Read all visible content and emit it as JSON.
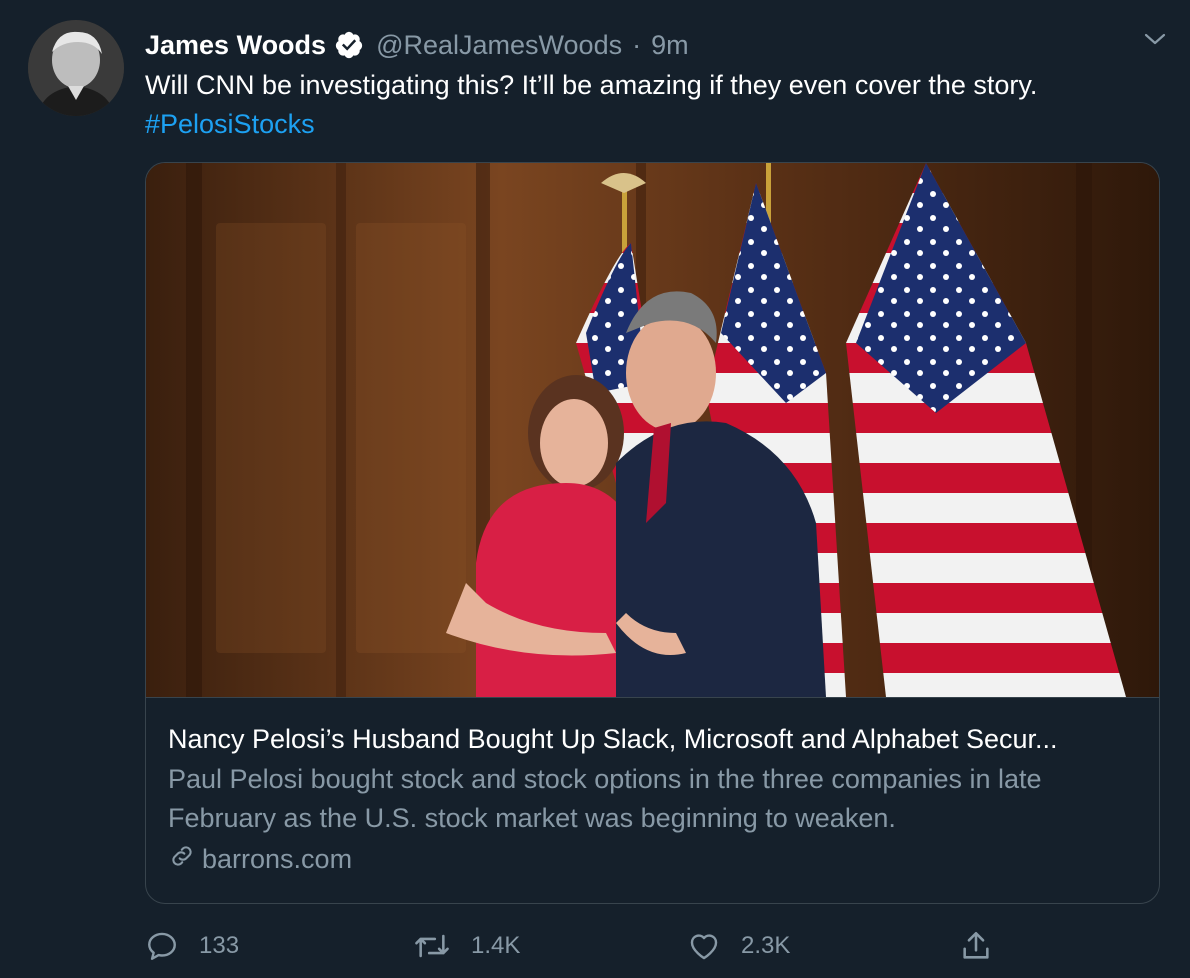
{
  "tweet": {
    "author_name": "James Woods",
    "handle": "@RealJamesWoods",
    "separator": "·",
    "time": "9m",
    "text": "Will CNN be investigating this? It’ll be amazing if they even cover the story.",
    "hashtag": "#PelosiStocks"
  },
  "card": {
    "title": "Nancy Pelosi’s Husband Bought Up Slack, Microsoft and Alphabet Secur...",
    "description": "Paul Pelosi bought stock and stock options in the three companies in late February as the U.S. stock market was beginning to weaken.",
    "domain": "barrons.com"
  },
  "actions": {
    "replies": "133",
    "retweets": "1.4K",
    "likes": "2.3K"
  },
  "icons": {
    "verified": "verified-badge-icon",
    "caret": "chevron-down-icon",
    "reply": "reply-icon",
    "retweet": "retweet-icon",
    "like": "heart-icon",
    "share": "share-icon",
    "link": "link-icon"
  },
  "colors": {
    "background": "#15202b",
    "border": "#38444d",
    "secondary_text": "#8899a6",
    "accent": "#1da1f2"
  }
}
